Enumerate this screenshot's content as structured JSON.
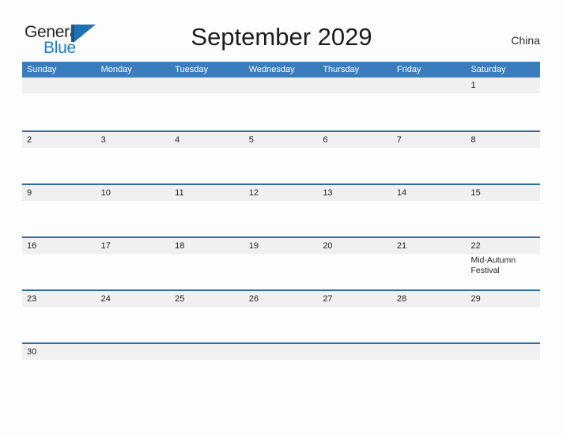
{
  "brand": {
    "name_part1": "General",
    "name_part2": "Blue",
    "mark_icon": "sail-triangle-icon"
  },
  "header": {
    "title": "September 2029",
    "country": "China"
  },
  "calendar": {
    "weekday_headers": [
      "Sunday",
      "Monday",
      "Tuesday",
      "Wednesday",
      "Thursday",
      "Friday",
      "Saturday"
    ],
    "colors": {
      "header_bar": "#3b7cbd",
      "row_divider": "#2e6da4",
      "daynum_band": "#f0f0f0",
      "brand_blue": "#1f7ac4",
      "page_background": "#fdfdfd"
    },
    "weeks": [
      {
        "index": 1,
        "days": [
          {
            "day": "",
            "event": ""
          },
          {
            "day": "",
            "event": ""
          },
          {
            "day": "",
            "event": ""
          },
          {
            "day": "",
            "event": ""
          },
          {
            "day": "",
            "event": ""
          },
          {
            "day": "",
            "event": ""
          },
          {
            "day": "1",
            "event": ""
          }
        ]
      },
      {
        "index": 2,
        "days": [
          {
            "day": "2",
            "event": ""
          },
          {
            "day": "3",
            "event": ""
          },
          {
            "day": "4",
            "event": ""
          },
          {
            "day": "5",
            "event": ""
          },
          {
            "day": "6",
            "event": ""
          },
          {
            "day": "7",
            "event": ""
          },
          {
            "day": "8",
            "event": ""
          }
        ]
      },
      {
        "index": 3,
        "days": [
          {
            "day": "9",
            "event": ""
          },
          {
            "day": "10",
            "event": ""
          },
          {
            "day": "11",
            "event": ""
          },
          {
            "day": "12",
            "event": ""
          },
          {
            "day": "13",
            "event": ""
          },
          {
            "day": "14",
            "event": ""
          },
          {
            "day": "15",
            "event": ""
          }
        ]
      },
      {
        "index": 4,
        "days": [
          {
            "day": "16",
            "event": ""
          },
          {
            "day": "17",
            "event": ""
          },
          {
            "day": "18",
            "event": ""
          },
          {
            "day": "19",
            "event": ""
          },
          {
            "day": "20",
            "event": ""
          },
          {
            "day": "21",
            "event": ""
          },
          {
            "day": "22",
            "event": "Mid-Autumn Festival"
          }
        ]
      },
      {
        "index": 5,
        "days": [
          {
            "day": "23",
            "event": ""
          },
          {
            "day": "24",
            "event": ""
          },
          {
            "day": "25",
            "event": ""
          },
          {
            "day": "26",
            "event": ""
          },
          {
            "day": "27",
            "event": ""
          },
          {
            "day": "28",
            "event": ""
          },
          {
            "day": "29",
            "event": ""
          }
        ]
      },
      {
        "index": 6,
        "days": [
          {
            "day": "30",
            "event": ""
          },
          {
            "day": "",
            "event": ""
          },
          {
            "day": "",
            "event": ""
          },
          {
            "day": "",
            "event": ""
          },
          {
            "day": "",
            "event": ""
          },
          {
            "day": "",
            "event": ""
          },
          {
            "day": "",
            "event": ""
          }
        ]
      }
    ]
  }
}
